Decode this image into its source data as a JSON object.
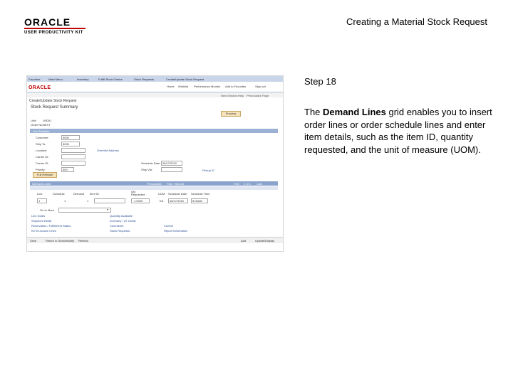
{
  "header": {
    "logo_main": "ORACLE",
    "logo_sub": "USER PRODUCTIVITY KIT",
    "title": "Creating a Material Stock Request"
  },
  "screenshot": {
    "nav": [
      "Favorites",
      "Main Menu",
      "Inventory",
      "Fulfill Stock Orders",
      "Stock Requests",
      "Create/Update Stock Request"
    ],
    "logo": "ORACLE",
    "toplinks": [
      "Home",
      "Worklist",
      "Performance Monitor",
      "Add to Favorites",
      "Sign out"
    ],
    "band": [
      "New Window",
      "Help",
      "Personalize Page"
    ],
    "page_heading": "Create/Update Stock Request",
    "summary_heading": "Stock Request Summary",
    "unit_label": "Unit:",
    "unit_value": "US001",
    "order_label": "Order No:",
    "order_value": "NEXT",
    "process_label": "Process",
    "line_defaults": "Line Defaults",
    "fields": [
      {
        "label": "Customer:",
        "value": "5000"
      },
      {
        "label": "Ship To:",
        "value": "5000"
      },
      {
        "label": "Location:",
        "value": ""
      },
      {
        "label": "Carrier ID:",
        "value": ""
      },
      {
        "label": "Carrier ID:",
        "value": ""
      },
      {
        "label": "Priority:",
        "value": "500"
      }
    ],
    "schedule_date_label": "Schedule Date:",
    "schedule_date_value": "06/17/2010",
    "override_address": "Override Address",
    "ship_via_label": "Ship Via:",
    "pickup_label": "Pickup ID",
    "more_label": "Full Release",
    "grid_title": "Demand Lines",
    "grid_links": [
      "Personalize",
      "Find",
      "View All",
      "First",
      "1 of 1",
      "Last"
    ],
    "columns": [
      "Line",
      "Schedule",
      "Demand",
      "Item ID",
      "Qty Requested",
      "UOM",
      "Schedule Date",
      "Schedule Time"
    ],
    "row": {
      "line": "1",
      "schedule": "1",
      "demand": "1",
      "qty": "1.0000",
      "uom": "EA",
      "date": "06/17/2010",
      "time": "5:00AM"
    },
    "go_to": "Go to More",
    "links_left": [
      "Line Notes",
      "Shipment Detail",
      "Reservation / Fulfillment Status",
      "Kit Re-source Lines"
    ],
    "links_mid": [
      "Quantity Available",
      "Inventory / UT Detail",
      "Comments",
      "Stock Requests"
    ],
    "links_right": [
      "Control",
      "Report Information"
    ],
    "footer_left": [
      "Save",
      "Return to Search",
      "Notify",
      "Refresh"
    ],
    "footer_right": [
      "Add",
      "Update/Display"
    ]
  },
  "step": {
    "label": "Step 18",
    "desc_prefix": "The ",
    "desc_bold": "Demand Lines",
    "desc_suffix": " grid enables you to insert order lines or order schedule lines and enter item details, such as the item ID, quantity requested, and the unit of measure (UOM)."
  }
}
